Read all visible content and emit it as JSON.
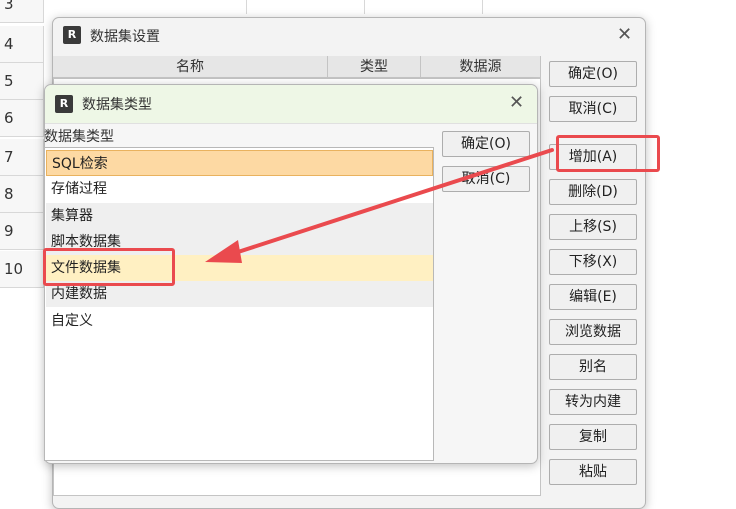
{
  "sheet": {
    "rows": [
      "3",
      "4",
      "5",
      "6",
      "7",
      "8",
      "9",
      "10"
    ]
  },
  "outer_dialog": {
    "title": "数据集设置",
    "icon_label": "R",
    "columns": [
      "名称",
      "类型",
      "数据源"
    ],
    "buttons": [
      "确定(O)",
      "取消(C)",
      "增加(A)",
      "删除(D)",
      "上移(S)",
      "下移(X)",
      "编辑(E)",
      "浏览数据",
      "别名",
      "转为内建",
      "复制",
      "粘贴"
    ]
  },
  "inner_dialog": {
    "title": "数据集类型",
    "icon_label": "R",
    "list_label": "数据集类型",
    "items": [
      "SQL检索",
      "存储过程",
      "集算器",
      "脚本数据集",
      "文件数据集",
      "内建数据",
      "自定义"
    ],
    "selected_index": 0,
    "highlighted_index": 4,
    "ok_label": "确定(O)",
    "cancel_label": "取消(C)"
  },
  "annotation": {
    "color": "#ea4a4e"
  }
}
